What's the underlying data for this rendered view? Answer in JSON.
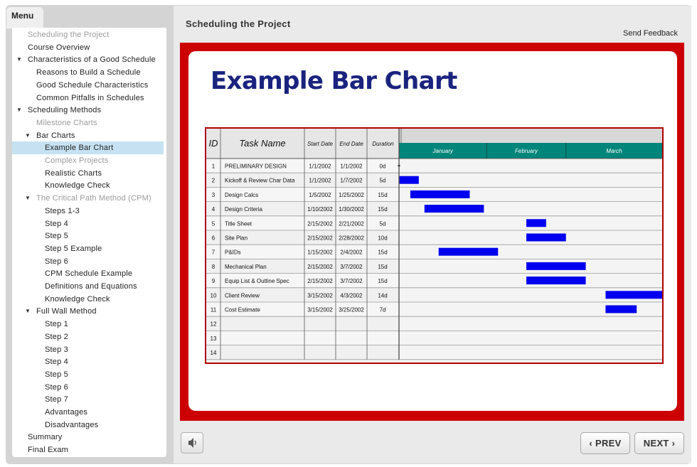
{
  "menu": {
    "tab_label": "Menu",
    "items": [
      {
        "label": "Scheduling the Project",
        "level": 0,
        "state": "disabled",
        "arrow": ""
      },
      {
        "label": "Course Overview",
        "level": 0,
        "state": "normal",
        "arrow": ""
      },
      {
        "label": "Characteristics of a Good Schedule",
        "level": 0,
        "state": "normal",
        "arrow": "down"
      },
      {
        "label": "Reasons to Build a Schedule",
        "level": 1,
        "state": "normal",
        "arrow": ""
      },
      {
        "label": "Good Schedule Characteristics",
        "level": 1,
        "state": "normal",
        "arrow": ""
      },
      {
        "label": "Common Pitfalls in Schedules",
        "level": 1,
        "state": "normal",
        "arrow": ""
      },
      {
        "label": "Scheduling Methods",
        "level": 0,
        "state": "normal",
        "arrow": "down"
      },
      {
        "label": "Milestone Charts",
        "level": 1,
        "state": "disabled",
        "arrow": ""
      },
      {
        "label": "Bar Charts",
        "level": 1,
        "state": "normal",
        "arrow": "down"
      },
      {
        "label": "Example Bar Chart",
        "level": 2,
        "state": "selected",
        "arrow": ""
      },
      {
        "label": "Complex Projects",
        "level": 2,
        "state": "disabled",
        "arrow": ""
      },
      {
        "label": "Realistic Charts",
        "level": 2,
        "state": "normal",
        "arrow": ""
      },
      {
        "label": "Knowledge Check",
        "level": 2,
        "state": "normal",
        "arrow": ""
      },
      {
        "label": "The Critical Path Method (CPM)",
        "level": 1,
        "state": "disabled",
        "arrow": "down"
      },
      {
        "label": "Steps 1-3",
        "level": 2,
        "state": "normal",
        "arrow": ""
      },
      {
        "label": "Step 4",
        "level": 2,
        "state": "normal",
        "arrow": ""
      },
      {
        "label": "Step 5",
        "level": 2,
        "state": "normal",
        "arrow": ""
      },
      {
        "label": "Step 5 Example",
        "level": 2,
        "state": "normal",
        "arrow": ""
      },
      {
        "label": "Step 6",
        "level": 2,
        "state": "normal",
        "arrow": ""
      },
      {
        "label": "CPM Schedule Example",
        "level": 2,
        "state": "normal",
        "arrow": ""
      },
      {
        "label": "Definitions and Equations",
        "level": 2,
        "state": "normal",
        "arrow": ""
      },
      {
        "label": "Knowledge Check",
        "level": 2,
        "state": "normal",
        "arrow": ""
      },
      {
        "label": "Full Wall Method",
        "level": 1,
        "state": "normal",
        "arrow": "down"
      },
      {
        "label": "Step 1",
        "level": 2,
        "state": "normal",
        "arrow": ""
      },
      {
        "label": "Step 2",
        "level": 2,
        "state": "normal",
        "arrow": ""
      },
      {
        "label": "Step 3",
        "level": 2,
        "state": "normal",
        "arrow": ""
      },
      {
        "label": "Step 4",
        "level": 2,
        "state": "normal",
        "arrow": ""
      },
      {
        "label": "Step 5",
        "level": 2,
        "state": "normal",
        "arrow": ""
      },
      {
        "label": "Step 6",
        "level": 2,
        "state": "normal",
        "arrow": ""
      },
      {
        "label": "Step 7",
        "level": 2,
        "state": "normal",
        "arrow": ""
      },
      {
        "label": "Advantages",
        "level": 2,
        "state": "normal",
        "arrow": ""
      },
      {
        "label": "Disadvantages",
        "level": 2,
        "state": "normal",
        "arrow": ""
      },
      {
        "label": "Summary",
        "level": 0,
        "state": "normal",
        "arrow": ""
      },
      {
        "label": "Final Exam",
        "level": 0,
        "state": "normal",
        "arrow": ""
      }
    ]
  },
  "header": {
    "title": "Scheduling the Project",
    "feedback_link": "Send Feedback"
  },
  "slide": {
    "heading": "Example Bar Chart"
  },
  "chart_data": {
    "type": "table",
    "columns": [
      "ID",
      "Task Name",
      "Start Date",
      "End Date",
      "Duration"
    ],
    "months": [
      "January",
      "February",
      "March"
    ],
    "timeline_start": "1/1/2002",
    "timeline_end": "4/3/2002",
    "rows": [
      {
        "id": "1",
        "task": "PRELIMINARY DESIGN",
        "start": "1/1/2002",
        "end": "1/1/2002",
        "duration": "0d"
      },
      {
        "id": "2",
        "task": "Kickoff & Review Char Data",
        "start": "1/1/2002",
        "end": "1/7/2002",
        "duration": "5d"
      },
      {
        "id": "3",
        "task": "Design Calcs",
        "start": "1/5/2002",
        "end": "1/25/2002",
        "duration": "15d"
      },
      {
        "id": "4",
        "task": "Design Criteria",
        "start": "1/10/2002",
        "end": "1/30/2002",
        "duration": "15d"
      },
      {
        "id": "5",
        "task": "Title Sheet",
        "start": "2/15/2002",
        "end": "2/21/2002",
        "duration": "5d"
      },
      {
        "id": "6",
        "task": "Site Plan",
        "start": "2/15/2002",
        "end": "2/28/2002",
        "duration": "10d"
      },
      {
        "id": "7",
        "task": "P&IDs",
        "start": "1/15/2002",
        "end": "2/4/2002",
        "duration": "15d"
      },
      {
        "id": "8",
        "task": "Mechanical Plan",
        "start": "2/15/2002",
        "end": "3/7/2002",
        "duration": "15d"
      },
      {
        "id": "9",
        "task": "Equip List & Outline Spec",
        "start": "2/15/2002",
        "end": "3/7/2002",
        "duration": "15d"
      },
      {
        "id": "10",
        "task": "Client Review",
        "start": "3/15/2002",
        "end": "4/3/2002",
        "duration": "14d"
      },
      {
        "id": "11",
        "task": "Cost Estimate",
        "start": "3/15/2002",
        "end": "3/25/2002",
        "duration": "7d"
      },
      {
        "id": "12",
        "task": "",
        "start": "",
        "end": "",
        "duration": ""
      },
      {
        "id": "13",
        "task": "",
        "start": "",
        "end": "",
        "duration": ""
      },
      {
        "id": "14",
        "task": "",
        "start": "",
        "end": "",
        "duration": ""
      }
    ],
    "bar_color": "#0000ee",
    "header_color": "#00857a"
  },
  "footer": {
    "prev_label": "PREV",
    "next_label": "NEXT",
    "volume_icon": "speaker-icon"
  },
  "colors": {
    "stage_border": "#cc0000",
    "heading": "#1a237e",
    "selected_menu": "#c6e2f2"
  }
}
